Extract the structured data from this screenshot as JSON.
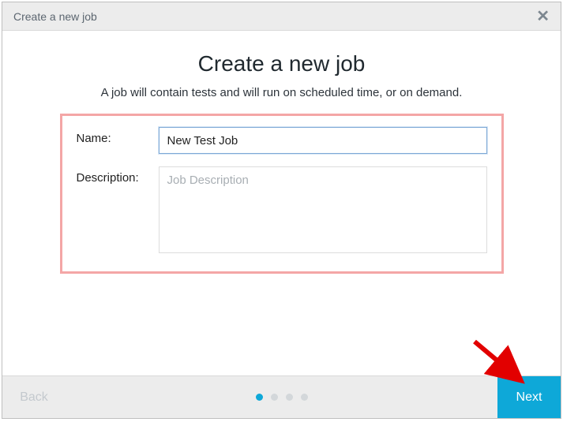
{
  "header": {
    "title": "Create a new job"
  },
  "page": {
    "title": "Create a new job",
    "subtitle": "A job will contain tests and will run on scheduled time, or on demand."
  },
  "form": {
    "name_label": "Name:",
    "name_value": "New Test Job",
    "description_label": "Description:",
    "description_value": "",
    "description_placeholder": "Job Description"
  },
  "footer": {
    "back_label": "Back",
    "next_label": "Next"
  },
  "stepper": {
    "total": 4,
    "current": 1
  },
  "colors": {
    "accent": "#0ea8d8",
    "highlight_border": "#f4a6a6"
  }
}
